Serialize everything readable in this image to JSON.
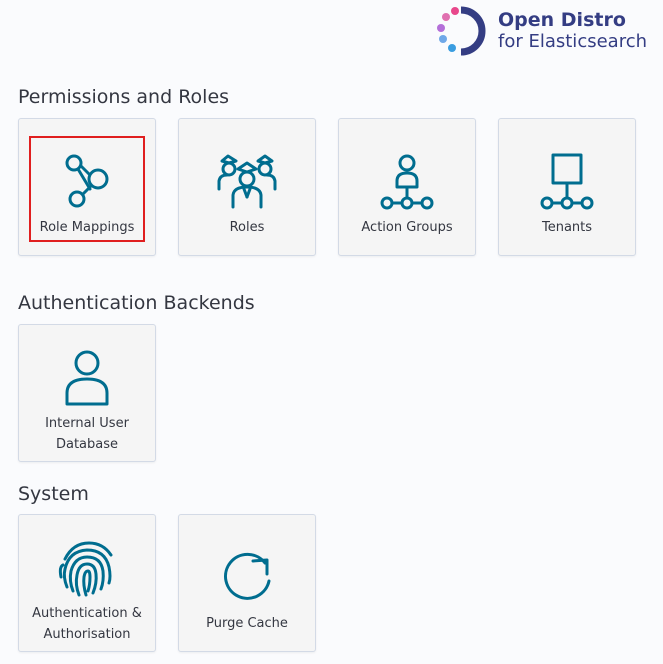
{
  "logo": {
    "line1": "Open Distro",
    "line2": "for Elasticsearch",
    "colors": {
      "pink": "#e8478b",
      "purple": "#b46fd9",
      "blue": "#3a9de0",
      "navy": "#343d83"
    }
  },
  "sections": [
    {
      "title": "Permissions and Roles"
    },
    {
      "title": "Authentication Backends"
    },
    {
      "title": "System"
    }
  ],
  "tiles": {
    "role_mappings": {
      "label": "Role Mappings",
      "icon": "role-mapping-icon",
      "selected": true
    },
    "roles": {
      "label": "Roles",
      "icon": "roles-icon"
    },
    "action_groups": {
      "label": "Action Groups",
      "icon": "action-groups-icon"
    },
    "tenants": {
      "label": "Tenants",
      "icon": "tenants-icon"
    },
    "internal_users": {
      "label_line1": "Internal User",
      "label_line2": "Database",
      "icon": "user-icon"
    },
    "auth": {
      "label_line1": "Authentication &",
      "label_line2": "Authorisation",
      "icon": "fingerprint-icon"
    },
    "purge_cache": {
      "label": "Purge Cache",
      "icon": "refresh-icon"
    }
  },
  "colors": {
    "icon": "#006d8f",
    "selection": "#e01e1e",
    "tile_bg": "#f5f5f5",
    "tile_border": "#d3dae6",
    "page_bg": "#fafbfd"
  }
}
